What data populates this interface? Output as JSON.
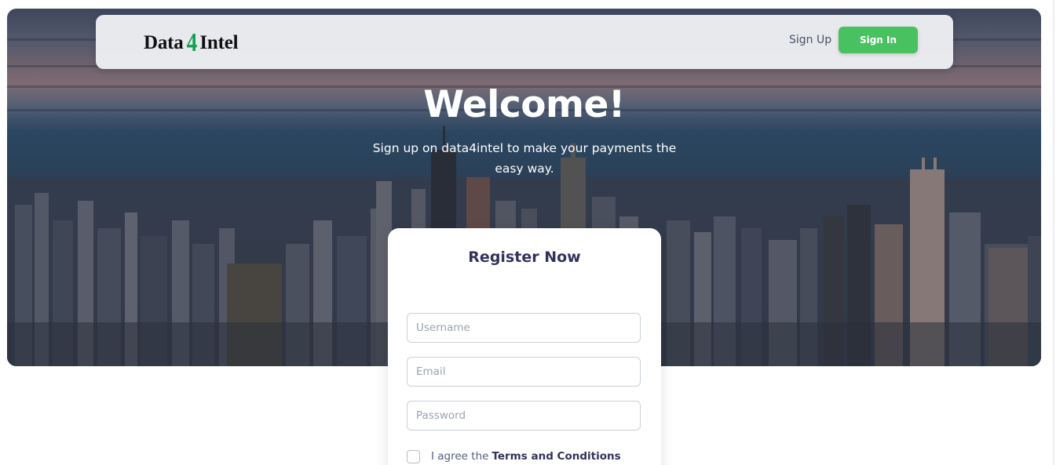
{
  "navbar": {
    "brand_prefix": "Data",
    "brand_number": "4",
    "brand_suffix": "Intel",
    "signup_label": "Sign Up",
    "signin_label": "Sign In"
  },
  "hero": {
    "title": "Welcome!",
    "subtitle": "Sign up on data4intel to make your payments the easy way."
  },
  "register": {
    "title": "Register Now",
    "username_placeholder": "Username",
    "email_placeholder": "Email",
    "password_placeholder": "Password",
    "terms_prefix": "I agree the",
    "terms_link": "Terms and Conditions",
    "terms_checked": false
  },
  "colors": {
    "accent_green": "#48c261",
    "brand_green": "#12a04f",
    "heading_text": "#32325d"
  }
}
